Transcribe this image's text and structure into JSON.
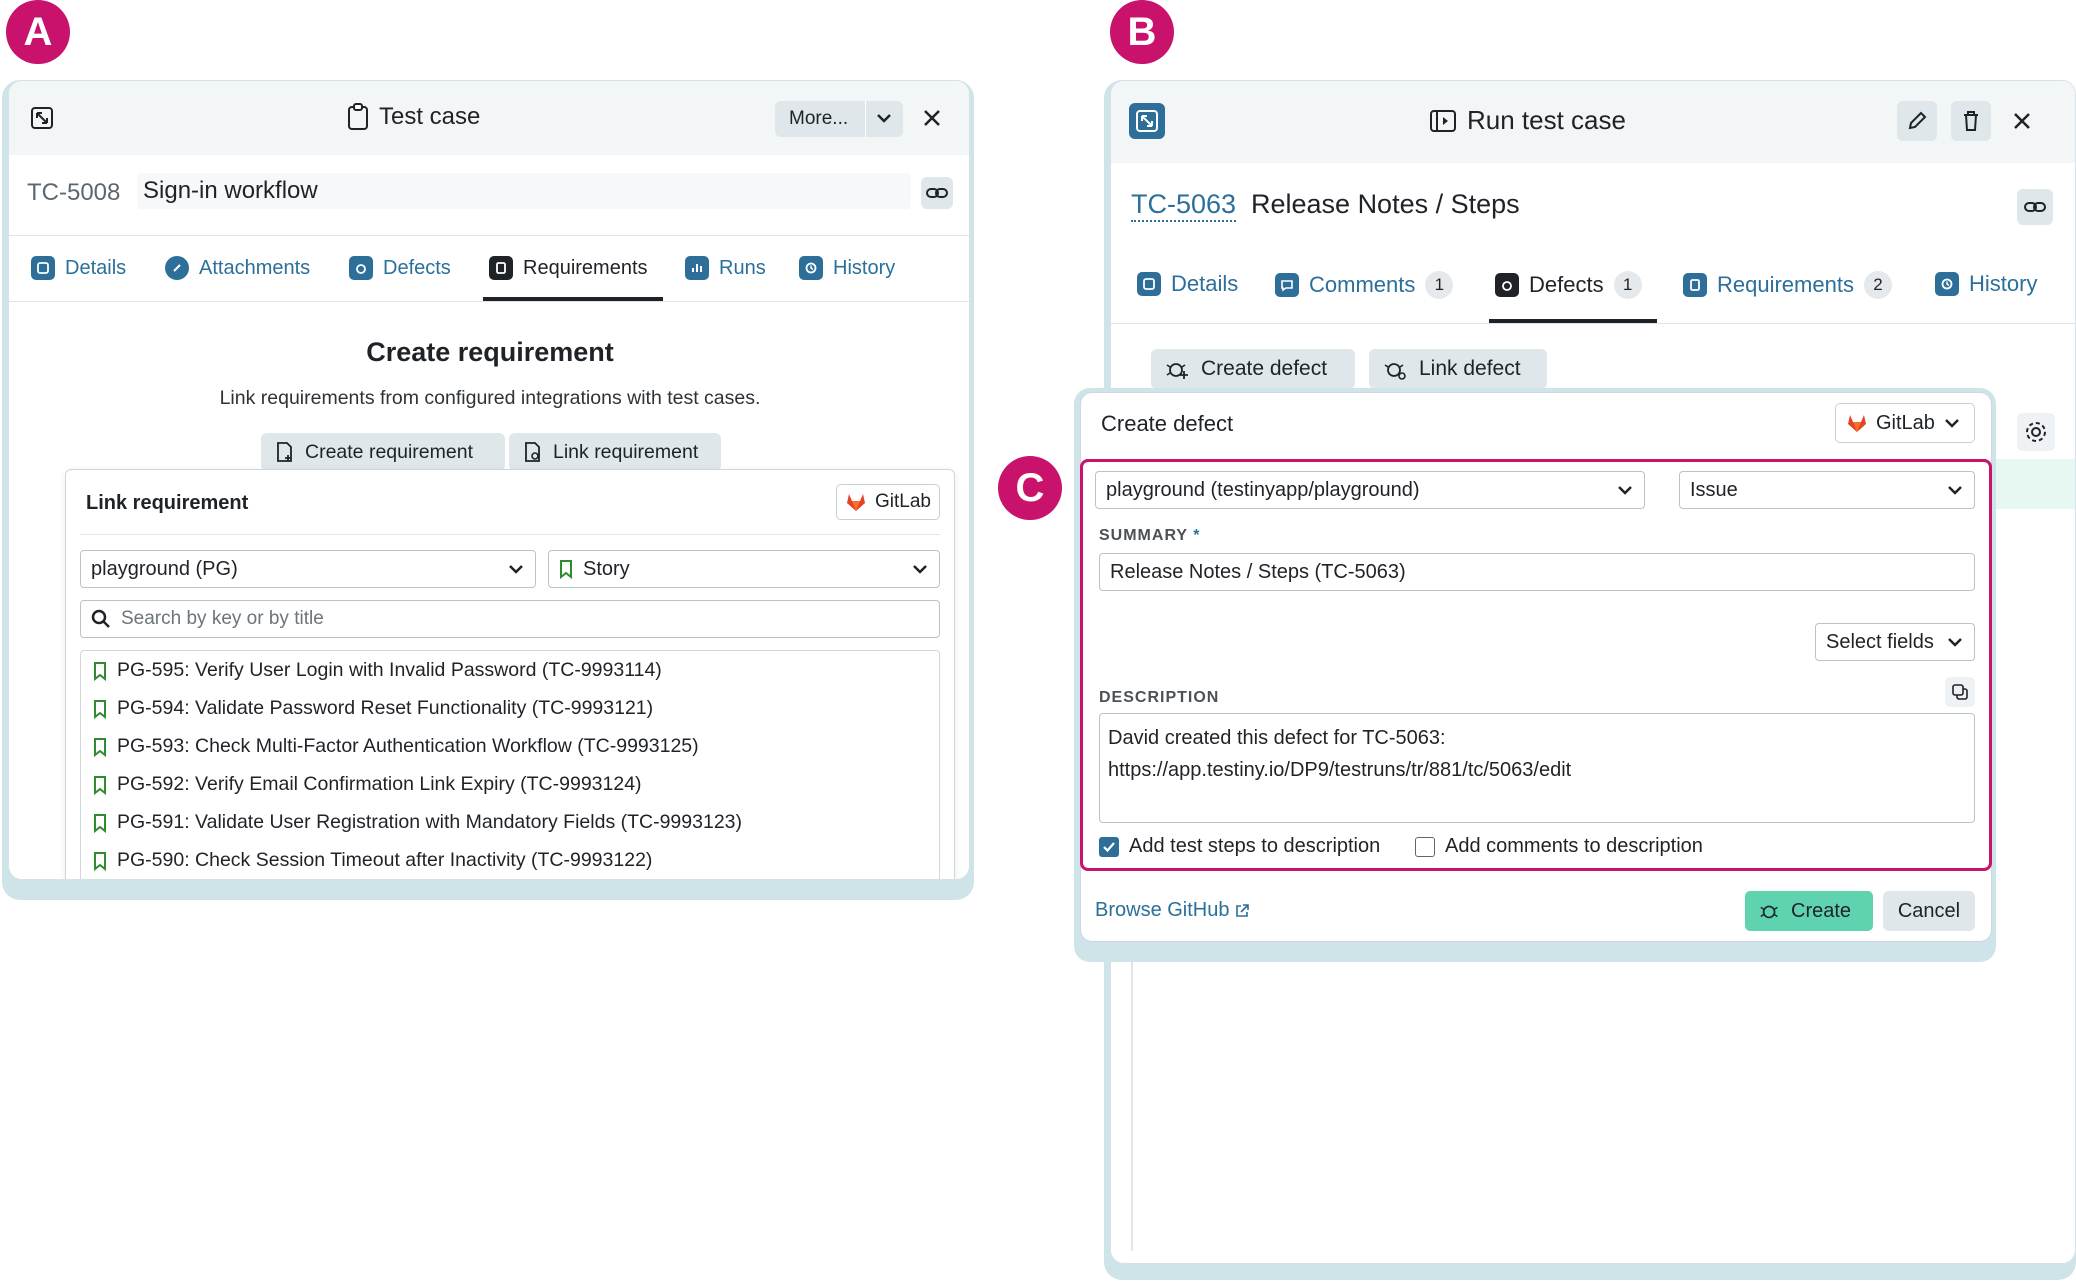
{
  "labels": {
    "a": "A",
    "b": "B",
    "c": "C"
  },
  "panel_a": {
    "title": "Test case",
    "more_label": "More...",
    "tc_key": "TC-5008",
    "tc_title": "Sign-in workflow",
    "tabs": [
      {
        "label": "Details"
      },
      {
        "label": "Attachments"
      },
      {
        "label": "Defects"
      },
      {
        "label": "Requirements"
      },
      {
        "label": "Runs"
      },
      {
        "label": "History"
      }
    ],
    "heading": "Create requirement",
    "subtext": "Link requirements from configured integrations with test cases.",
    "create_btn": "Create requirement",
    "link_btn": "Link requirement",
    "link_panel": {
      "title": "Link requirement",
      "integration": "GitLab",
      "project": "playground (PG)",
      "type": "Story",
      "search_placeholder": "Search by key or by title",
      "items": [
        "PG-595: Verify User Login with Invalid Password (TC-9993114)",
        "PG-594: Validate Password Reset Functionality (TC-9993121)",
        "PG-593: Check Multi-Factor Authentication Workflow (TC-9993125)",
        "PG-592: Verify Email Confirmation Link Expiry (TC-9993124)",
        "PG-591: Validate User Registration with Mandatory Fields (TC-9993123)",
        "PG-590: Check Session Timeout after Inactivity (TC-9993122)"
      ]
    }
  },
  "panel_b": {
    "title": "Run test case",
    "tc_key": "TC-5063",
    "tc_title": "Release Notes / Steps",
    "tabs": [
      {
        "label": "Details",
        "count": ""
      },
      {
        "label": "Comments",
        "count": "1"
      },
      {
        "label": "Defects",
        "count": "1"
      },
      {
        "label": "Requirements",
        "count": "2"
      },
      {
        "label": "History",
        "count": ""
      }
    ],
    "create_defect_btn": "Create defect",
    "link_defect_btn": "Link defect",
    "dialog": {
      "title": "Create defect",
      "integration": "GitLab",
      "project": "playground (testinyapp/playground)",
      "issue_type": "Issue",
      "summary_label": "SUMMARY",
      "required_mark": "*",
      "summary_value": "Release Notes / Steps (TC-5063)",
      "select_fields": "Select fields",
      "description_label": "DESCRIPTION",
      "description_line1": "David created this defect for TC-5063:",
      "description_line2": "https://app.testiny.io/DP9/testruns/tr/881/tc/5063/edit",
      "check_steps": "Add test steps to description",
      "check_comments": "Add comments to description",
      "browse_link": "Browse GitHub",
      "create_btn": "Create",
      "cancel_btn": "Cancel"
    }
  },
  "colors": {
    "accent_magenta": "#c8126b",
    "tab_blue": "#2d6f99",
    "create_green": "#5fd3b0"
  }
}
